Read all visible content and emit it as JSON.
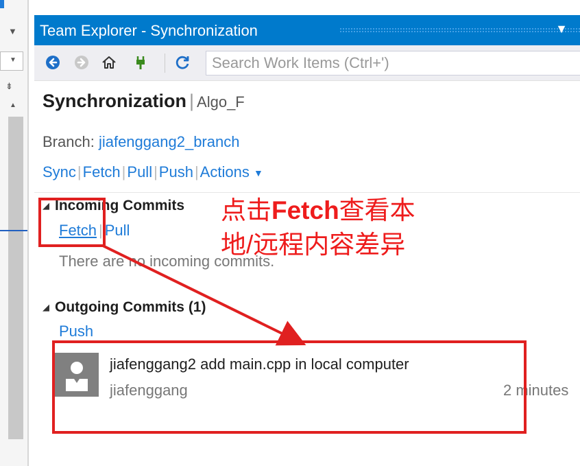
{
  "window": {
    "title": "Team Explorer - Synchronization",
    "dropdown_icon": "chevron-down-icon"
  },
  "toolbar": {
    "back_icon": "back-arrow-icon",
    "forward_icon": "forward-arrow-icon",
    "home_icon": "home-icon",
    "connect_icon": "plug-icon",
    "refresh_icon": "refresh-icon",
    "search_placeholder": "Search Work Items (Ctrl+')"
  },
  "page": {
    "title": "Synchronization",
    "separator": "|",
    "repo": "Algo_F"
  },
  "branch": {
    "label": "Branch:",
    "name": "jiafenggang2_branch"
  },
  "actions": {
    "sync": "Sync",
    "fetch": "Fetch",
    "pull": "Pull",
    "push": "Push",
    "more": "Actions"
  },
  "incoming": {
    "heading": "Incoming Commits",
    "fetch": "Fetch",
    "pull": "Pull",
    "empty_message": "There are no incoming commits."
  },
  "outgoing": {
    "heading": "Outgoing Commits (1)",
    "push": "Push",
    "commits": [
      {
        "message": "jiafenggang2 add main.cpp in local computer",
        "author": "jiafenggang",
        "time": "2 minutes"
      }
    ]
  },
  "annotation": {
    "line1_prefix": "点击",
    "line1_bold": "Fetch",
    "line1_suffix": "查看本",
    "line2": "地/远程内容差异",
    "color": "#ee1c1c"
  },
  "colors": {
    "accent": "#007acc",
    "link": "#1e7bd8",
    "annotation": "#e02020"
  }
}
